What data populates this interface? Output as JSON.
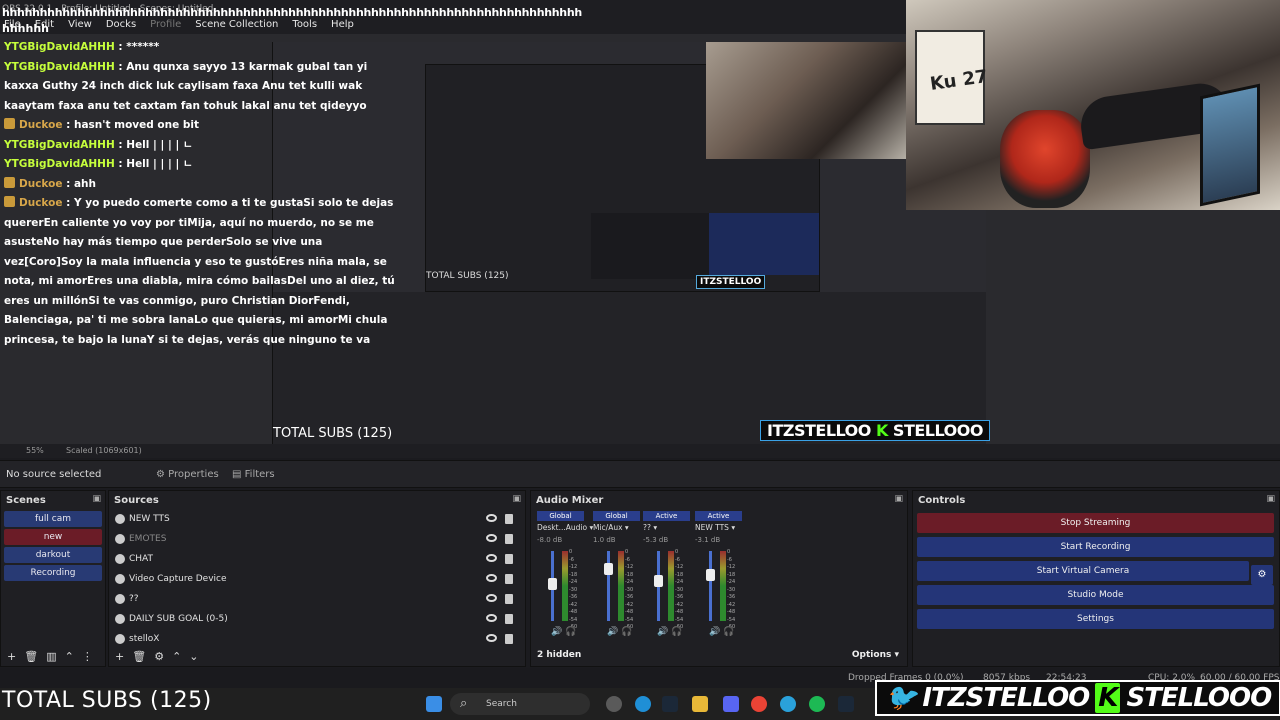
{
  "window": {
    "title": "OBS 32.0.1 - Profile: Untitled - Scenes: Untitled",
    "spam_line1": "hhhhhhhhhhhhhhhhhhhhhhhhhhhhhhhhhhhhhhhhhhhhhhhhhhhhhhhhhhhhhhhhhhhhhhhhhhhhh",
    "spam_line2": "hhhhhh"
  },
  "menu": {
    "items": [
      "File",
      "Edit",
      "View",
      "Docks",
      "Profile",
      "Scene Collection",
      "Tools",
      "Help"
    ]
  },
  "chat": {
    "messages": [
      {
        "user": "YTGBigDavidAHHH",
        "text": " : ******",
        "user_color": "#c6ff3c",
        "badge": false
      },
      {
        "user": "YTGBigDavidAHHH",
        "text": " : Anu qunxa sayyo 13 karmak gubal tan yi kaxxa Guthy 24 inch dick luk caylisam faxa Anu tet kulli wak kaaytam faxa anu tet caxtam fan tohuk lakal anu tet qideyyo",
        "user_color": "#c6ff3c",
        "badge": false
      },
      {
        "user": "Duckoe",
        "text": " : hasn't moved one bit",
        "user_color": "#d7a64a",
        "badge": true
      },
      {
        "user": "YTGBigDavidAHHH",
        "text": " : Hell | | | | ㄴ",
        "user_color": "#c6ff3c",
        "badge": false
      },
      {
        "user": "YTGBigDavidAHHH",
        "text": " : Hell | | | | ㄴ",
        "user_color": "#c6ff3c",
        "badge": false
      },
      {
        "user": "Duckoe",
        "text": " : ahh",
        "user_color": "#d7a64a",
        "badge": true
      },
      {
        "user": "Duckoe",
        "text": " : Y yo puedo comerte como a ti te gustaSi solo te dejas quererEn caliente yo voy por tiMija, aquí no muerdo, no se me asusteNo hay más tiempo que perderSolo se vive una vez[Coro]Soy la mala influencia y eso te gustóEres niña mala, se nota, mi amorEres una diabla, mira cómo bailasDel uno al diez, tú eres un millónSi te vas conmigo, puro Christian DiorFendi, Balenciaga, pa' ti me sobra lanaLo que quieras, mi amorMi chula princesa, te bajo la lunaY si te dejas, verás que ninguno te va",
        "user_color": "#d7a64a",
        "badge": true
      }
    ]
  },
  "preview": {
    "zoom": "55%",
    "scale": "Scaled (1069x601)",
    "nested_total_subs": "TOTAL SUBS (125)",
    "nested_sign": "Ku 27",
    "overlay_total_subs": "TOTAL SUBS (125)",
    "overlay_logo_left": "ITZSTELLOO",
    "overlay_logo_right": "STELLOOO",
    "overlay_logo_k": "K"
  },
  "source_bar": {
    "no_source": "No source selected",
    "properties": "Properties",
    "filters": "Filters"
  },
  "scenes": {
    "title": "Scenes",
    "items": [
      {
        "label": "full cam",
        "active": false
      },
      {
        "label": "new",
        "active": true
      },
      {
        "label": "darkout",
        "active": false
      },
      {
        "label": "Recording",
        "active": false
      }
    ]
  },
  "sources": {
    "title": "Sources",
    "items": [
      {
        "label": "NEW TTS",
        "icon": "globe-icon",
        "dim": false
      },
      {
        "label": "EMOTES",
        "icon": "globe-icon",
        "dim": true
      },
      {
        "label": "CHAT",
        "icon": "globe-icon",
        "dim": false
      },
      {
        "label": "Video Capture Device",
        "icon": "camera-icon",
        "dim": false
      },
      {
        "label": "??",
        "icon": "globe-icon",
        "dim": false
      },
      {
        "label": "DAILY SUB GOAL (0-5)",
        "icon": "text-icon",
        "dim": false
      },
      {
        "label": "stelloX",
        "icon": "image-icon",
        "dim": false
      }
    ]
  },
  "mixer": {
    "title": "Audio Mixer",
    "channels": [
      {
        "header": "Global",
        "name": "Deskt...Audio",
        "db": "-8.0 dB",
        "level": 0.55,
        "monitor_active": false
      },
      {
        "header": "Global",
        "name": "Mic/Aux",
        "db": "1.0 dB",
        "level": 0.8,
        "monitor_active": false
      },
      {
        "header": "Active",
        "name": "??",
        "db": "-5.3 dB",
        "level": 0.6,
        "monitor_active": true
      },
      {
        "header": "Active",
        "name": "NEW TTS",
        "db": "-3.1 dB",
        "level": 0.7,
        "monitor_active": false
      }
    ],
    "scale": [
      "0",
      "-6",
      "-12",
      "-18",
      "-24",
      "-30",
      "-36",
      "-42",
      "-48",
      "-54",
      "-60"
    ],
    "hidden": "2 hidden",
    "options": "Options"
  },
  "controls": {
    "title": "Controls",
    "stop_streaming": "Stop Streaming",
    "start_recording": "Start Recording",
    "start_virtual_camera": "Start Virtual Camera",
    "studio_mode": "Studio Mode",
    "settings": "Settings"
  },
  "status": {
    "dropped": "Dropped Frames 0 (0.0%)",
    "kbps": "8057 kbps",
    "time": "22:54:23",
    "cpu": "CPU: 2.0%",
    "fps": "60.00 / 60.00 FPS"
  },
  "taskbar": {
    "search": "Search",
    "total_subs": "TOTAL SUBS (125)",
    "brand_left": "ITZSTELLOO",
    "brand_k": "K",
    "brand_right": "STELLOOO"
  },
  "colors": {
    "accent_blue": "#243578",
    "active_red": "#6b1c27",
    "kick_green": "#53fc18",
    "twitter_blue": "#1d9bf0"
  }
}
